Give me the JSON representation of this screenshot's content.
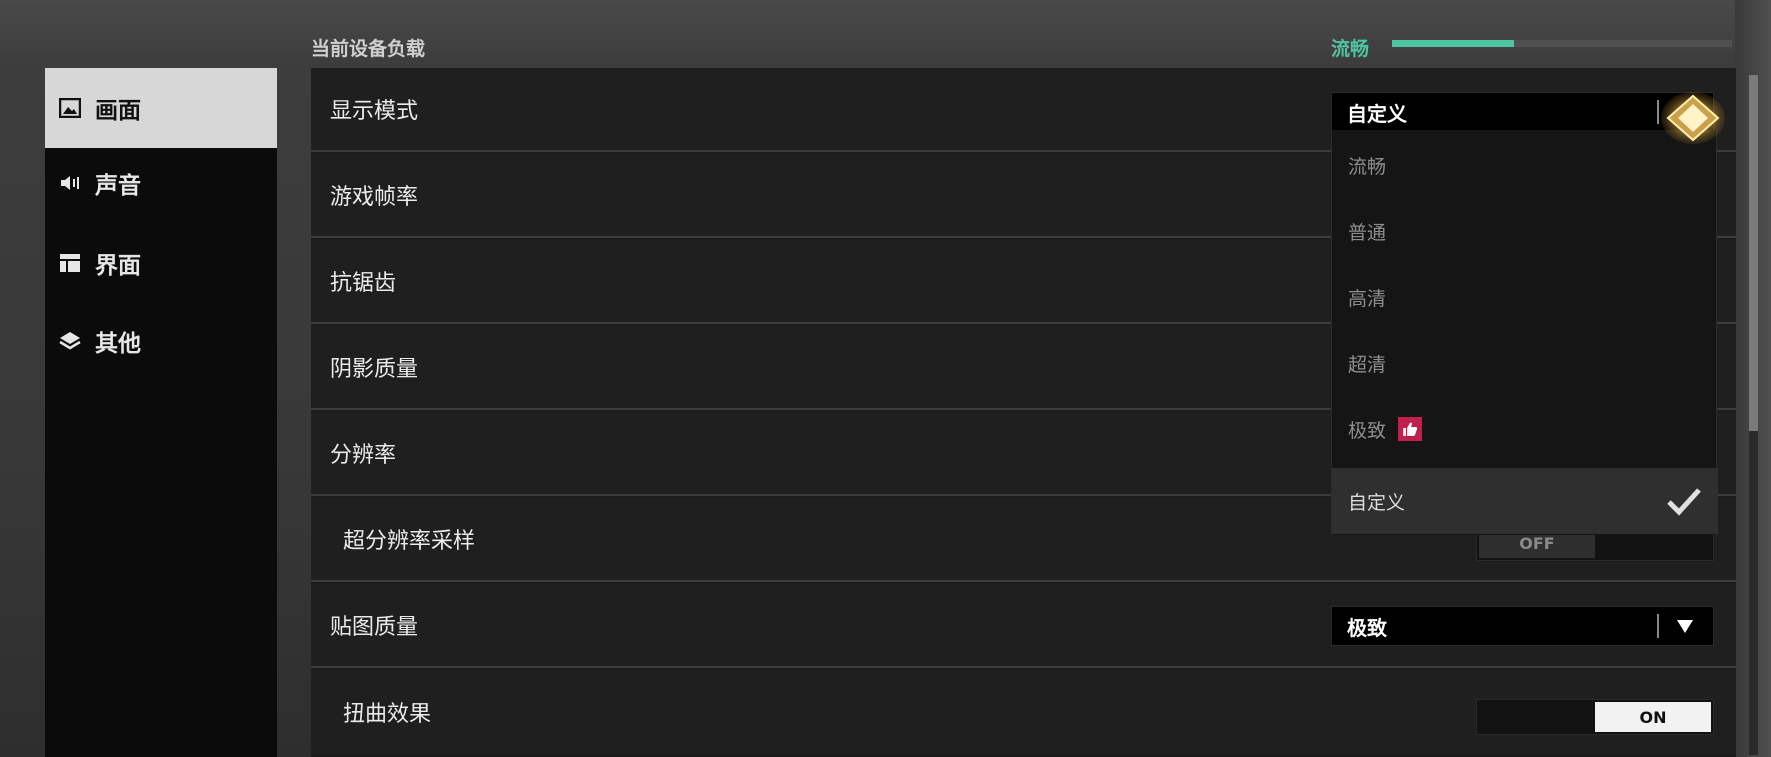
{
  "header": {
    "title": "当前设备负载",
    "load_label": "流畅",
    "load_level": 0.36
  },
  "sidebar": {
    "items": [
      {
        "label": "画面",
        "icon": "image-icon",
        "active": true
      },
      {
        "label": "声音",
        "icon": "speaker-icon",
        "active": false
      },
      {
        "label": "界面",
        "icon": "layout-icon",
        "active": false
      },
      {
        "label": "其他",
        "icon": "layers-icon",
        "active": false
      }
    ]
  },
  "settings": {
    "rows": [
      {
        "label": "显示模式",
        "control": "select",
        "value": "自定义",
        "expanded": true
      },
      {
        "label": "游戏帧率"
      },
      {
        "label": "抗锯齿"
      },
      {
        "label": "阴影质量"
      },
      {
        "label": "分辨率"
      },
      {
        "label": "超分辨率采样",
        "control": "toggle",
        "value": "OFF"
      },
      {
        "label": "贴图质量",
        "control": "select",
        "value": "极致"
      },
      {
        "label": "扭曲效果",
        "control": "toggle",
        "value": "ON"
      }
    ]
  },
  "display_mode_dropdown": {
    "options": [
      {
        "label": "流畅"
      },
      {
        "label": "普通"
      },
      {
        "label": "高清"
      },
      {
        "label": "超清"
      },
      {
        "label": "极致",
        "badge": "thumbs-up-icon"
      },
      {
        "label": "自定义",
        "selected": true
      }
    ]
  },
  "colors": {
    "accent": "#4fc4a0",
    "badge": "#c1204d",
    "active_nav": "#d7d7d7"
  }
}
